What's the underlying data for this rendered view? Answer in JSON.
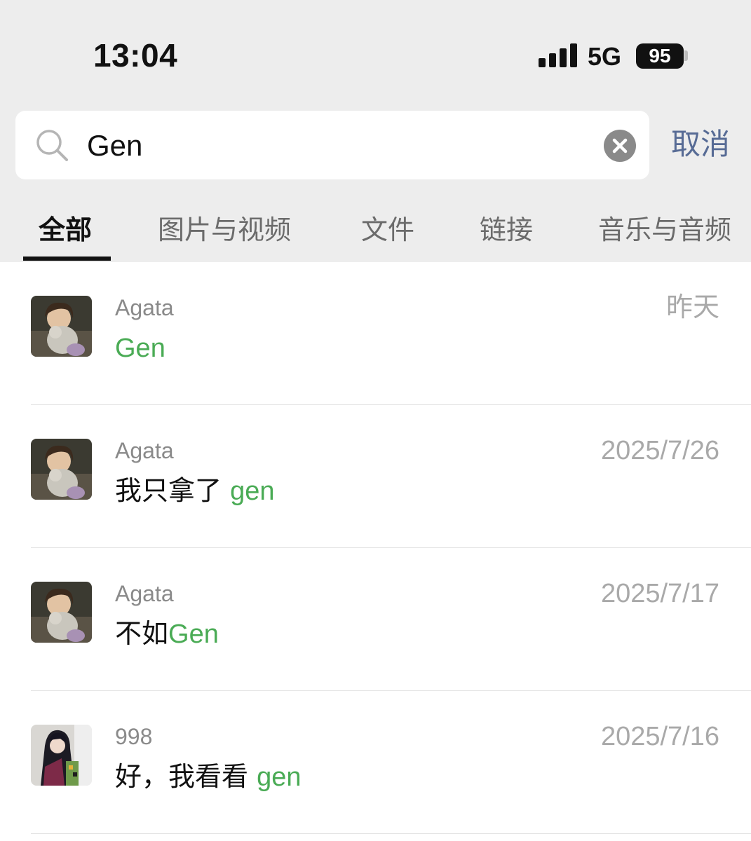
{
  "status_bar": {
    "time": "13:04",
    "network": "5G",
    "battery": "95"
  },
  "search": {
    "query": "Gen",
    "cancel_label": "取消"
  },
  "tabs": [
    {
      "label": "全部",
      "active": true
    },
    {
      "label": "图片与视频",
      "active": false
    },
    {
      "label": "文件",
      "active": false
    },
    {
      "label": "链接",
      "active": false
    },
    {
      "label": "音乐与音频",
      "active": false
    }
  ],
  "colors": {
    "highlight": "#4aab55",
    "link": "#576b95",
    "background": "#ededed"
  },
  "results": [
    {
      "sender": "Agata",
      "prefix": "",
      "match": "Gen",
      "date": "昨天",
      "avatar": "anime-boy-avatar"
    },
    {
      "sender": "Agata",
      "prefix": "我只拿了 ",
      "match": "gen",
      "date": "2025/7/26",
      "avatar": "anime-boy-avatar"
    },
    {
      "sender": "Agata",
      "prefix": "不如",
      "match": "Gen",
      "date": "2025/7/17",
      "avatar": "anime-boy-avatar"
    },
    {
      "sender": "998",
      "prefix": "好，我看看 ",
      "match": "gen",
      "date": "2025/7/16",
      "avatar": "anime-swordsman-avatar"
    }
  ]
}
